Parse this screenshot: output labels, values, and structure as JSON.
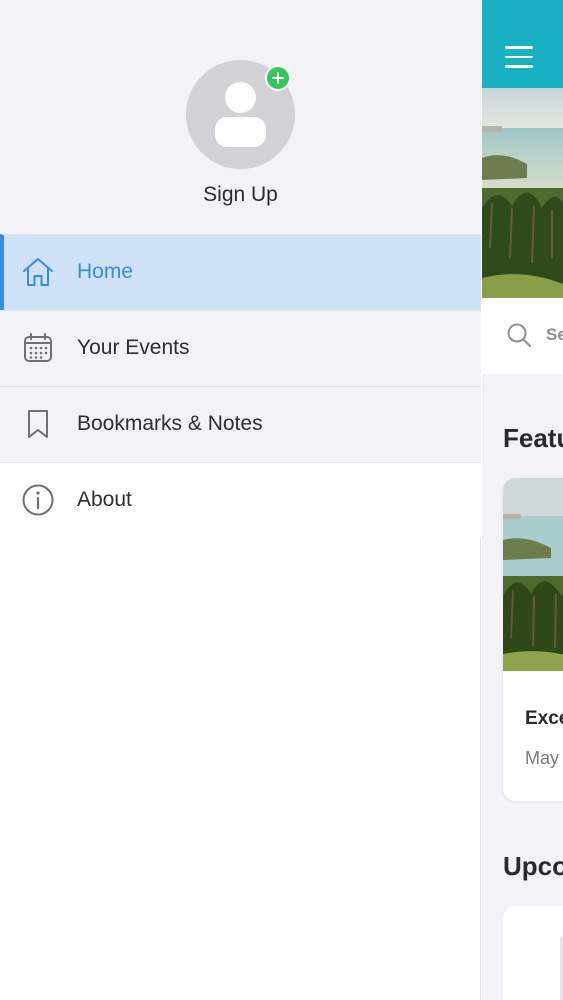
{
  "drawer": {
    "signup_label": "Sign Up",
    "items": [
      {
        "label": "Home",
        "icon": "home-icon",
        "active": true
      },
      {
        "label": "Your Events",
        "icon": "calendar-icon",
        "active": false
      },
      {
        "label": "Bookmarks & Notes",
        "icon": "bookmark-icon",
        "active": false
      },
      {
        "label": "About",
        "icon": "info-icon",
        "active": false
      }
    ]
  },
  "main": {
    "search_placeholder": "Se",
    "featured_title": "Featu",
    "featured_card": {
      "title": "Exce",
      "date": "May"
    },
    "upcoming_title": "Upco"
  },
  "colors": {
    "navbar": "#1ab0c4",
    "accent": "#3a8be8",
    "active_bg": "#cfe2f8",
    "badge": "#34c759"
  }
}
